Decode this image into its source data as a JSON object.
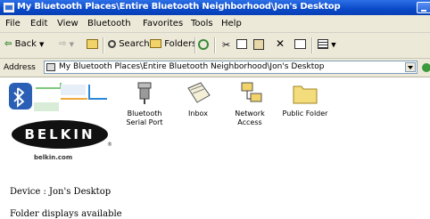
{
  "window": {
    "title": "My Bluetooth Places\\Entire Bluetooth Neighborhood\\Jon's Desktop"
  },
  "menu": [
    "File",
    "Edit",
    "View",
    "Bluetooth",
    "Favorites",
    "Tools",
    "Help"
  ],
  "toolbar": {
    "back_label": "Back",
    "search_label": "Search",
    "folders_label": "Folders"
  },
  "address": {
    "label": "Address",
    "value": "My Bluetooth Places\\Entire Bluetooth Neighborhood\\Jon's Desktop"
  },
  "logo": {
    "brand": "BELKIN",
    "site": "belkin.com",
    "registered": "®"
  },
  "icons": [
    {
      "line1": "Bluetooth",
      "line2": "Serial Port"
    },
    {
      "line1": "Inbox",
      "line2": ""
    },
    {
      "line1": "Network",
      "line2": "Access"
    },
    {
      "line1": "Public Folder",
      "line2": ""
    }
  ],
  "status": {
    "device": "Device : Jon's Desktop",
    "folder": "Folder displays available"
  }
}
